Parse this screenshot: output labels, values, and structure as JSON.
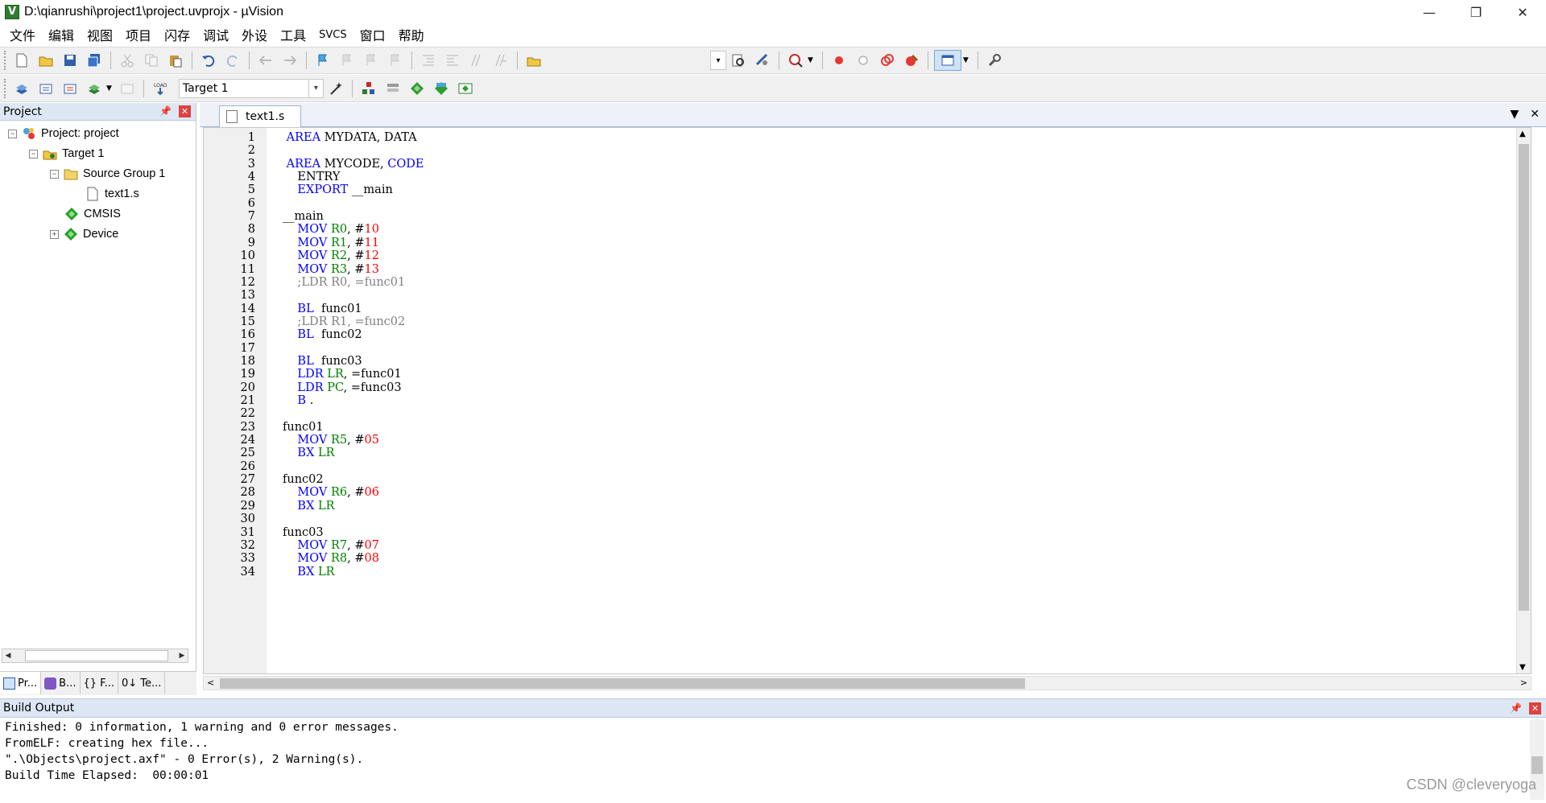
{
  "window": {
    "title": "D:\\qianrushi\\project1\\project.uvprojx - µVision",
    "controls": {
      "minimize": "—",
      "restore": "❐",
      "close": "✕"
    }
  },
  "menu": [
    "文件",
    "编辑",
    "视图",
    "项目",
    "闪存",
    "调试",
    "外设",
    "工具",
    "SVCS",
    "窗口",
    "帮助"
  ],
  "toolbar2": {
    "target_select": "Target 1"
  },
  "project_panel": {
    "title": "Project",
    "tree": [
      {
        "label": "Project: project",
        "icon": "project-icon",
        "expander": "−"
      },
      {
        "label": "Target 1",
        "icon": "target-icon",
        "expander": "−"
      },
      {
        "label": "Source Group 1",
        "icon": "folder-icon",
        "expander": "−"
      },
      {
        "label": "text1.s",
        "icon": "file-icon",
        "expander": ""
      },
      {
        "label": "CMSIS",
        "icon": "green-diamond-icon",
        "expander": ""
      },
      {
        "label": "Device",
        "icon": "green-diamond-icon",
        "expander": "+"
      }
    ],
    "bottom_tabs": [
      "Pr...",
      "B...",
      "{} F...",
      "0↓ Te..."
    ]
  },
  "editor": {
    "active_tab": "text1.s",
    "lines": [
      {
        "n": "1",
        "t": [
          [
            "kw",
            " AREA"
          ],
          [
            "",
            " MYDATA, DATA"
          ]
        ]
      },
      {
        "n": "2",
        "t": []
      },
      {
        "n": "3",
        "t": [
          [
            "kw",
            " AREA"
          ],
          [
            "",
            " MYCODE, "
          ],
          [
            "kw",
            "CODE"
          ]
        ]
      },
      {
        "n": "4",
        "t": [
          [
            "",
            "    ENTRY"
          ]
        ]
      },
      {
        "n": "5",
        "t": [
          [
            "kw",
            "    EXPORT"
          ],
          [
            "",
            " __main"
          ]
        ]
      },
      {
        "n": "6",
        "t": []
      },
      {
        "n": "7",
        "t": [
          [
            "",
            "__main"
          ]
        ]
      },
      {
        "n": "8",
        "t": [
          [
            "kw",
            "    MOV"
          ],
          [
            "",
            " "
          ],
          [
            "reg",
            "R0"
          ],
          [
            "",
            ", #"
          ],
          [
            "num",
            "10"
          ]
        ]
      },
      {
        "n": "9",
        "t": [
          [
            "kw",
            "    MOV"
          ],
          [
            "",
            " "
          ],
          [
            "reg",
            "R1"
          ],
          [
            "",
            ", #"
          ],
          [
            "num",
            "11"
          ]
        ]
      },
      {
        "n": "10",
        "t": [
          [
            "kw",
            "    MOV"
          ],
          [
            "",
            " "
          ],
          [
            "reg",
            "R2"
          ],
          [
            "",
            ", #"
          ],
          [
            "num",
            "12"
          ]
        ]
      },
      {
        "n": "11",
        "t": [
          [
            "kw",
            "    MOV"
          ],
          [
            "",
            " "
          ],
          [
            "reg",
            "R3"
          ],
          [
            "",
            ", #"
          ],
          [
            "num",
            "13"
          ]
        ]
      },
      {
        "n": "12",
        "t": [
          [
            "cm",
            "    ;LDR R0, =func01"
          ]
        ]
      },
      {
        "n": "13",
        "t": []
      },
      {
        "n": "14",
        "t": [
          [
            "kw",
            "    BL"
          ],
          [
            "",
            "  func01"
          ]
        ]
      },
      {
        "n": "15",
        "t": [
          [
            "cm",
            "    ;LDR R1, =func02"
          ]
        ]
      },
      {
        "n": "16",
        "t": [
          [
            "kw",
            "    BL"
          ],
          [
            "",
            "  func02"
          ]
        ]
      },
      {
        "n": "17",
        "t": []
      },
      {
        "n": "18",
        "t": [
          [
            "kw",
            "    BL"
          ],
          [
            "",
            "  func03"
          ]
        ]
      },
      {
        "n": "19",
        "t": [
          [
            "kw",
            "    LDR"
          ],
          [
            "",
            " "
          ],
          [
            "reg",
            "LR"
          ],
          [
            "",
            ", =func01"
          ]
        ]
      },
      {
        "n": "20",
        "t": [
          [
            "kw",
            "    LDR"
          ],
          [
            "",
            " "
          ],
          [
            "reg",
            "PC"
          ],
          [
            "",
            ", =func03"
          ]
        ]
      },
      {
        "n": "21",
        "t": [
          [
            "kw",
            "    B"
          ],
          [
            "",
            " ."
          ]
        ]
      },
      {
        "n": "22",
        "t": []
      },
      {
        "n": "23",
        "t": [
          [
            "",
            "func01"
          ]
        ]
      },
      {
        "n": "24",
        "t": [
          [
            "kw",
            "    MOV"
          ],
          [
            "",
            " "
          ],
          [
            "reg",
            "R5"
          ],
          [
            "",
            ", #"
          ],
          [
            "num",
            "05"
          ]
        ]
      },
      {
        "n": "25",
        "t": [
          [
            "kw",
            "    BX"
          ],
          [
            "",
            " "
          ],
          [
            "reg",
            "LR"
          ]
        ]
      },
      {
        "n": "26",
        "t": []
      },
      {
        "n": "27",
        "t": [
          [
            "",
            "func02"
          ]
        ]
      },
      {
        "n": "28",
        "t": [
          [
            "kw",
            "    MOV"
          ],
          [
            "",
            " "
          ],
          [
            "reg",
            "R6"
          ],
          [
            "",
            ", #"
          ],
          [
            "num",
            "06"
          ]
        ]
      },
      {
        "n": "29",
        "t": [
          [
            "kw",
            "    BX"
          ],
          [
            "",
            " "
          ],
          [
            "reg",
            "LR"
          ]
        ]
      },
      {
        "n": "30",
        "t": []
      },
      {
        "n": "31",
        "t": [
          [
            "",
            "func03"
          ]
        ]
      },
      {
        "n": "32",
        "t": [
          [
            "kw",
            "    MOV"
          ],
          [
            "",
            " "
          ],
          [
            "reg",
            "R7"
          ],
          [
            "",
            ", #"
          ],
          [
            "num",
            "07"
          ]
        ]
      },
      {
        "n": "33",
        "t": [
          [
            "kw",
            "    MOV"
          ],
          [
            "",
            " "
          ],
          [
            "reg",
            "R8"
          ],
          [
            "",
            ", #"
          ],
          [
            "num",
            "08"
          ]
        ]
      },
      {
        "n": "34",
        "t": [
          [
            "kw",
            "    BX"
          ],
          [
            "",
            " "
          ],
          [
            "reg",
            "LR"
          ]
        ]
      }
    ]
  },
  "build_output": {
    "title": "Build Output",
    "lines": [
      "Finished: 0 information, 1 warning and 0 error messages.",
      "FromELF: creating hex file...",
      "\".\\Objects\\project.axf\" - 0 Error(s), 2 Warning(s).",
      "Build Time Elapsed:  00:00:01"
    ]
  },
  "watermark": "CSDN @cleveryoga",
  "colors": {
    "keyword": "#0000ff",
    "register": "#008000",
    "number": "#ff0000",
    "comment": "#808080",
    "panel_header": "#dde7f3"
  }
}
